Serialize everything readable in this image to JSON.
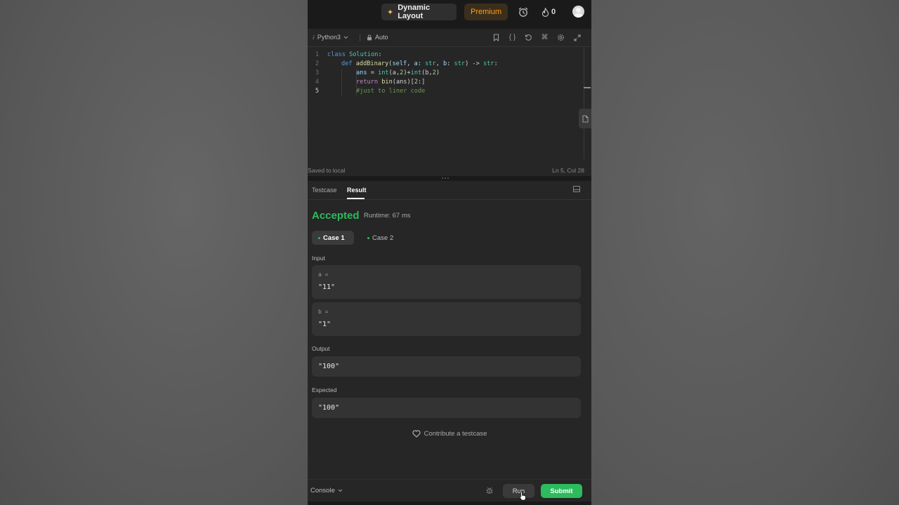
{
  "topbar": {
    "dynamic_layout_label": "Dynamic Layout",
    "premium_label": "Premium",
    "streak_count": "0"
  },
  "editor": {
    "language": "Python3",
    "mode": "Auto",
    "lines": [
      {
        "no": "1"
      },
      {
        "no": "2"
      },
      {
        "no": "3"
      },
      {
        "no": "4"
      },
      {
        "no": "5"
      }
    ],
    "code": {
      "l1_kw": "class",
      "l1_cls": "Solution",
      "l1_end": ":",
      "l2_kw": "def",
      "l2_fn": "addBinary",
      "l2_a": "(",
      "l2_self": "self",
      "l2_b": ", ",
      "l2_pa": "a",
      "l2_c": ": ",
      "l2_ta": "str",
      "l2_d": ", ",
      "l2_pb": "b",
      "l2_e": ": ",
      "l2_tb": "str",
      "l2_f": ") -> ",
      "l2_tr": "str",
      "l2_g": ":",
      "l3_var": "ans",
      "l3_eq": " = ",
      "l3_fn1": "int",
      "l3_a1": "(a,",
      "l3_n1": "2",
      "l3_a2": ")+",
      "l3_fn2": "int",
      "l3_a3": "(b,",
      "l3_n2": "2",
      "l3_a4": ")",
      "l4_kw": "return",
      "l4_sp": " ",
      "l4_fn": "bin",
      "l4_a": "(ans)[",
      "l4_n": "2",
      "l4_b": ":]",
      "l5_cmt": "#just to liner code"
    },
    "saved_status": "Saved to local",
    "cursor_pos": "Ln 5, Col 28"
  },
  "result": {
    "tabs": [
      {
        "label": "Testcase"
      },
      {
        "label": "Result"
      }
    ],
    "status": "Accepted",
    "runtime": "Runtime: 67 ms",
    "cases": [
      {
        "label": "Case 1"
      },
      {
        "label": "Case 2"
      }
    ],
    "input_label": "Input",
    "inputs": [
      {
        "name": "a =",
        "value": "\"11\""
      },
      {
        "name": "b =",
        "value": "\"1\""
      }
    ],
    "output_label": "Output",
    "output_value": "\"100\"",
    "expected_label": "Expected",
    "expected_value": "\"100\"",
    "contribute_label": "Contribute a testcase"
  },
  "bottombar": {
    "console_label": "Console",
    "run_label": "Run",
    "submit_label": "Submit"
  },
  "colors": {
    "accepted": "#2cbb5d",
    "premium": "#ffa116",
    "submit": "#2cbb5d"
  }
}
